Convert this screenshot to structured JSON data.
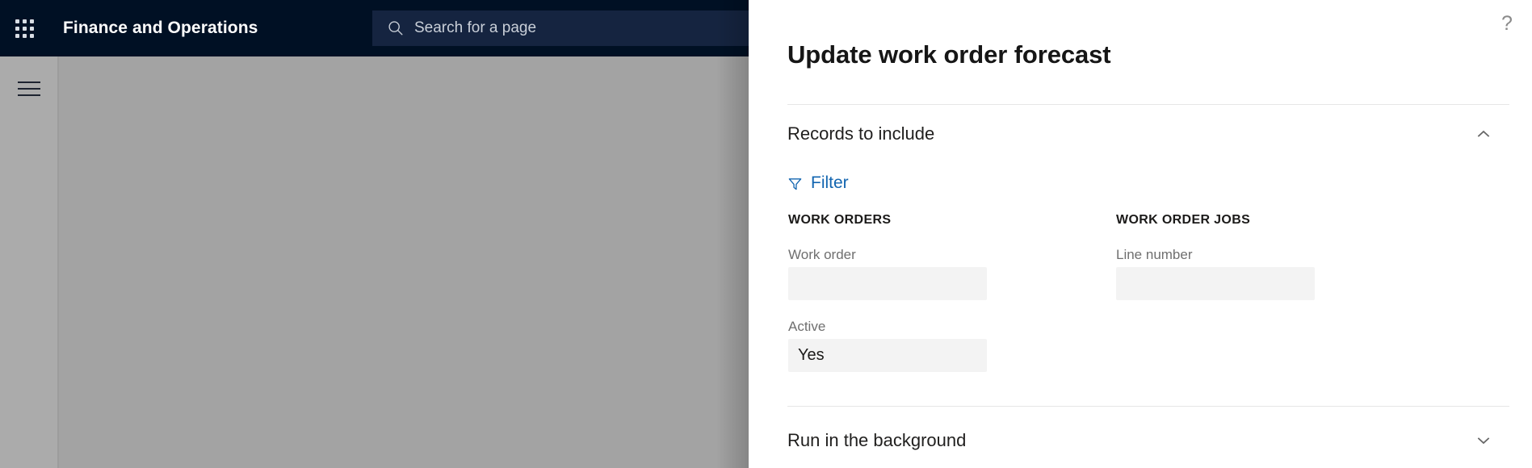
{
  "topbar": {
    "waffle_icon": "app-launcher-waffle-icon",
    "app_title": "Finance and Operations",
    "search_icon": "search-icon",
    "search_placeholder": "Search for a page",
    "search_value": ""
  },
  "nav": {
    "hamburger_icon": "hamburger-menu-icon"
  },
  "panel": {
    "help_icon": "help-question-mark-icon",
    "title": "Update work order forecast",
    "sections": [
      {
        "id": "records-to-include",
        "label": "Records to include",
        "expanded": true,
        "chevron_icon": "chevron-up-icon"
      },
      {
        "id": "run-in-the-background",
        "label": "Run in the background",
        "expanded": false,
        "chevron_icon": "chevron-down-icon"
      }
    ],
    "filter": {
      "icon": "funnel-filter-icon",
      "label": "Filter"
    },
    "columns": [
      {
        "heading": "WORK ORDERS",
        "fields": [
          {
            "label": "Work order",
            "value": "",
            "placeholder": ""
          },
          {
            "label": "Active",
            "value": "Yes",
            "placeholder": ""
          }
        ]
      },
      {
        "heading": "WORK ORDER JOBS",
        "fields": [
          {
            "label": "Line number",
            "value": "",
            "placeholder": ""
          }
        ]
      }
    ]
  },
  "colors": {
    "navy": "#001024",
    "search_field": "#152440",
    "link_blue": "#1265b0",
    "input_fill": "#f3f3f3",
    "backdrop_grey": "#a3a3a3",
    "rail_grey": "#ababab"
  }
}
